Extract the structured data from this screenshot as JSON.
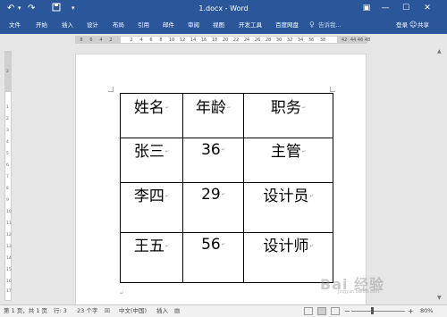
{
  "title_bar": {
    "doc_title": "1.docx - Word",
    "undo_icon": "undo-icon",
    "redo_icon": "redo-icon",
    "save_icon": "save-icon"
  },
  "tabs": [
    "文件",
    "开始",
    "插入",
    "设计",
    "布局",
    "引用",
    "邮件",
    "审阅",
    "视图",
    "开发工具",
    "百度网盘"
  ],
  "search_hint": "告诉我...",
  "login_label": "登录",
  "share_label": "共享",
  "ruler": {
    "left_numbers": [
      "8",
      "6",
      "4",
      "2"
    ],
    "numbers": [
      "2",
      "4",
      "6",
      "8",
      "10",
      "12",
      "14",
      "16",
      "18",
      "20",
      "22",
      "24",
      "26",
      "28",
      "30",
      "32",
      "34",
      "36",
      "38"
    ],
    "right_numbers": [
      "42",
      "44",
      "46",
      "48"
    ]
  },
  "vertical_ruler": [
    "2",
    "1",
    "2",
    "3",
    "4",
    "5",
    "6",
    "7",
    "8",
    "9",
    "10",
    "11",
    "12",
    "13",
    "14",
    "15",
    "16",
    "17",
    "18"
  ],
  "table": {
    "rows": [
      [
        "姓名",
        "年龄",
        "职务"
      ],
      [
        "张三",
        "36",
        "主管"
      ],
      [
        "李四",
        "29",
        "设计员"
      ],
      [
        "王五",
        "56",
        "设计师"
      ]
    ]
  },
  "status": {
    "page": "第 1 页，共 1 页",
    "row": "行: 3",
    "words": "23 个字",
    "language": "中文(中国)",
    "mode": "插入",
    "zoom": "80%",
    "zoom_level": 0.8
  },
  "watermark": {
    "text": "Bai 经验",
    "sub": "jingyan.baidu.com"
  }
}
